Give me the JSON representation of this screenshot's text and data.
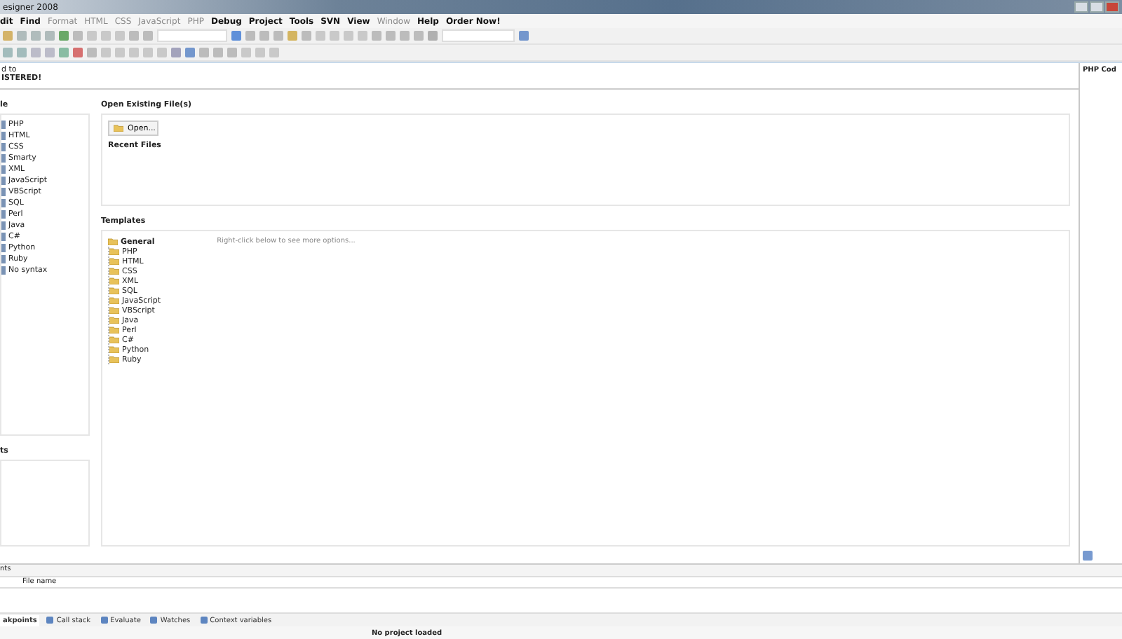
{
  "window": {
    "title": "esigner 2008"
  },
  "menu": [
    {
      "label": "dit",
      "disabled": false
    },
    {
      "label": "Find",
      "disabled": false
    },
    {
      "label": "Format",
      "disabled": true
    },
    {
      "label": "HTML",
      "disabled": true
    },
    {
      "label": "CSS",
      "disabled": true
    },
    {
      "label": "JavaScript",
      "disabled": true
    },
    {
      "label": "PHP",
      "disabled": true
    },
    {
      "label": "Debug",
      "disabled": false
    },
    {
      "label": "Project",
      "disabled": false
    },
    {
      "label": "Tools",
      "disabled": false
    },
    {
      "label": "SVN",
      "disabled": false
    },
    {
      "label": "View",
      "disabled": false
    },
    {
      "label": "Window",
      "disabled": true
    },
    {
      "label": "Help",
      "disabled": false
    },
    {
      "label": "Order Now!",
      "disabled": false
    }
  ],
  "header": {
    "line_1": "d to",
    "line_2": "ISTERED!"
  },
  "new_file": {
    "title": "le",
    "items": [
      "PHP",
      "HTML",
      "CSS",
      "Smarty",
      "XML",
      "JavaScript",
      "VBScript",
      "SQL",
      "Perl",
      "Java",
      "C#",
      "Python",
      "Ruby",
      "No syntax"
    ]
  },
  "projects": {
    "title": "ts"
  },
  "open_existing": {
    "title": "Open Existing File(s)",
    "button": "Open...",
    "recent_title": "Recent Files"
  },
  "templates": {
    "title": "Templates",
    "hint": "Right-click below to see more options...",
    "tree": [
      {
        "label": "General",
        "children": [
          {
            "label": "PHP"
          },
          {
            "label": "HTML"
          },
          {
            "label": "CSS"
          },
          {
            "label": "XML"
          },
          {
            "label": "SQL"
          },
          {
            "label": "JavaScript"
          },
          {
            "label": "VBScript"
          },
          {
            "label": "Java"
          },
          {
            "label": "Perl"
          },
          {
            "label": "C#"
          },
          {
            "label": "Python"
          },
          {
            "label": "Ruby"
          }
        ]
      }
    ]
  },
  "right_panel": {
    "title": "PHP Cod"
  },
  "bottom_panel": {
    "title": "nts",
    "column": "File name"
  },
  "debug_tabs": [
    {
      "label": "akpoints",
      "selected": true
    },
    {
      "label": "Call stack",
      "selected": false
    },
    {
      "label": "Evaluate",
      "selected": false
    },
    {
      "label": "Watches",
      "selected": false
    },
    {
      "label": "Context variables",
      "selected": false
    }
  ],
  "status_bar": {
    "text": "No project loaded"
  }
}
